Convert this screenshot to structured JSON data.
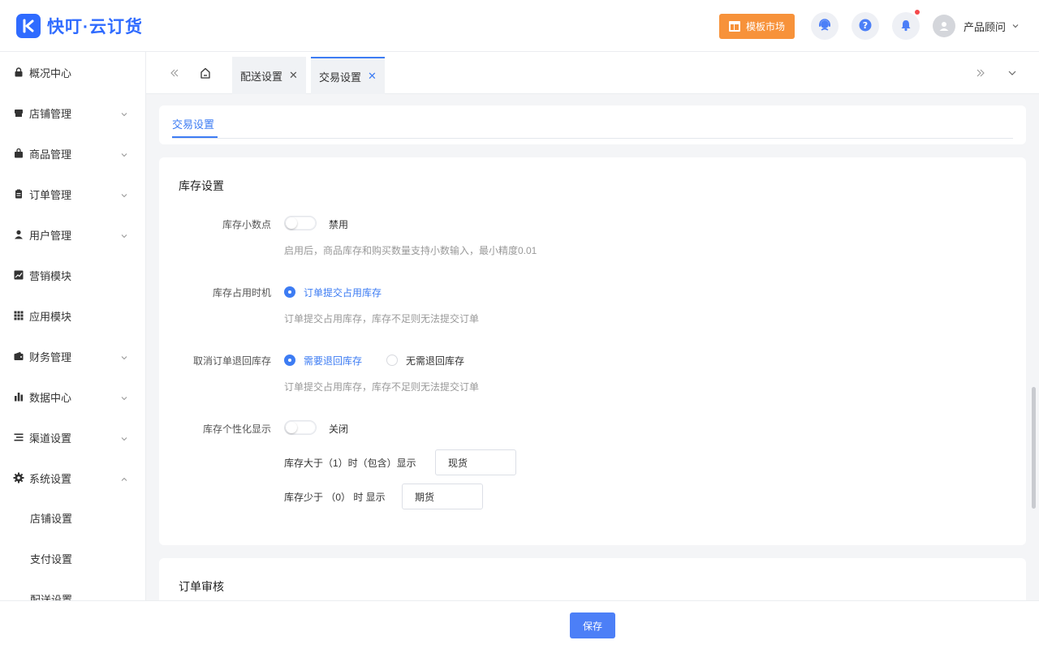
{
  "app": {
    "logo_text": "快叮·云订货",
    "brand_color": "#2f6bff"
  },
  "header": {
    "template_market_label": "模板市场",
    "template_market_color": "#f7923a",
    "icons": [
      "support-icon",
      "help-icon",
      "bell-icon"
    ],
    "has_notification_dot": true,
    "user_name": "产品顾问"
  },
  "sidebar": {
    "items": [
      {
        "label": "概况中心",
        "icon": "lock-icon",
        "expandable": false
      },
      {
        "label": "店铺管理",
        "icon": "store-icon",
        "expandable": true
      },
      {
        "label": "商品管理",
        "icon": "bag-icon",
        "expandable": true
      },
      {
        "label": "订单管理",
        "icon": "clipboard-icon",
        "expandable": true
      },
      {
        "label": "用户管理",
        "icon": "person-icon",
        "expandable": true
      },
      {
        "label": "营销模块",
        "icon": "trend-icon",
        "expandable": false
      },
      {
        "label": "应用模块",
        "icon": "grid-icon",
        "expandable": false
      },
      {
        "label": "财务管理",
        "icon": "wallet-icon",
        "expandable": true
      },
      {
        "label": "数据中心",
        "icon": "bar-chart-icon",
        "expandable": true
      },
      {
        "label": "渠道设置",
        "icon": "list-icon",
        "expandable": true
      },
      {
        "label": "系统设置",
        "icon": "gear-icon",
        "expandable": true,
        "expanded": true
      }
    ],
    "sub_items": [
      "店铺设置",
      "支付设置",
      "配送设置"
    ]
  },
  "tabs": {
    "items": [
      {
        "label": "配送设置",
        "active": false
      },
      {
        "label": "交易设置",
        "active": true
      }
    ]
  },
  "page": {
    "inner_tab": "交易设置",
    "stock_section": {
      "title": "库存设置",
      "decimal": {
        "label": "库存小数点",
        "switch_on": false,
        "switch_text": "禁用",
        "hint": "启用后，商品库存和购买数量支持小数输入，最小精度0.01"
      },
      "occupy": {
        "label": "库存占用时机",
        "option": "订单提交占用库存",
        "selected": true,
        "hint": "订单提交占用库存，库存不足则无法提交订单"
      },
      "cancel_return": {
        "label": "取消订单退回库存",
        "options": [
          {
            "label": "需要退回库存",
            "selected": true
          },
          {
            "label": "无需退回库存",
            "selected": false
          }
        ],
        "hint": "订单提交占用库存，库存不足则无法提交订单"
      },
      "custom_display": {
        "label": "库存个性化显示",
        "switch_on": false,
        "switch_text": "关闭",
        "row1_text": "库存大于（1）时（包含）显示",
        "row1_value": "现货",
        "row2_text": "库存少于 （0） 时 显示",
        "row2_value": "期货"
      }
    },
    "order_review_section": {
      "title": "订单审核"
    },
    "accent_color": "#3d7cf3"
  },
  "footer": {
    "save_label": "保存"
  }
}
